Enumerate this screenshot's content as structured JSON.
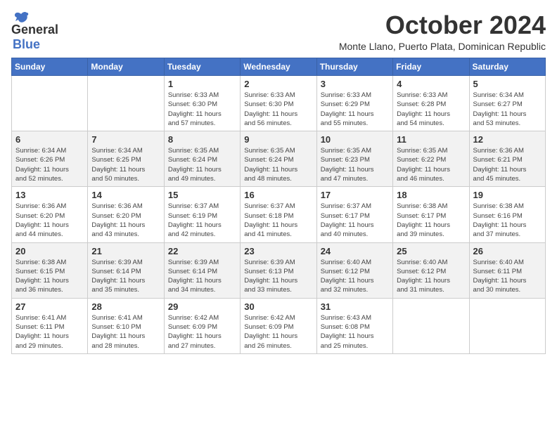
{
  "logo": {
    "text_general": "General",
    "text_blue": "Blue",
    "bird_unicode": "🐦"
  },
  "header": {
    "month": "October 2024",
    "location": "Monte Llano, Puerto Plata, Dominican Republic"
  },
  "days_of_week": [
    "Sunday",
    "Monday",
    "Tuesday",
    "Wednesday",
    "Thursday",
    "Friday",
    "Saturday"
  ],
  "weeks": [
    [
      {
        "day": "",
        "info": ""
      },
      {
        "day": "",
        "info": ""
      },
      {
        "day": "1",
        "info": "Sunrise: 6:33 AM\nSunset: 6:30 PM\nDaylight: 11 hours\nand 57 minutes."
      },
      {
        "day": "2",
        "info": "Sunrise: 6:33 AM\nSunset: 6:30 PM\nDaylight: 11 hours\nand 56 minutes."
      },
      {
        "day": "3",
        "info": "Sunrise: 6:33 AM\nSunset: 6:29 PM\nDaylight: 11 hours\nand 55 minutes."
      },
      {
        "day": "4",
        "info": "Sunrise: 6:33 AM\nSunset: 6:28 PM\nDaylight: 11 hours\nand 54 minutes."
      },
      {
        "day": "5",
        "info": "Sunrise: 6:34 AM\nSunset: 6:27 PM\nDaylight: 11 hours\nand 53 minutes."
      }
    ],
    [
      {
        "day": "6",
        "info": "Sunrise: 6:34 AM\nSunset: 6:26 PM\nDaylight: 11 hours\nand 52 minutes."
      },
      {
        "day": "7",
        "info": "Sunrise: 6:34 AM\nSunset: 6:25 PM\nDaylight: 11 hours\nand 50 minutes."
      },
      {
        "day": "8",
        "info": "Sunrise: 6:35 AM\nSunset: 6:24 PM\nDaylight: 11 hours\nand 49 minutes."
      },
      {
        "day": "9",
        "info": "Sunrise: 6:35 AM\nSunset: 6:24 PM\nDaylight: 11 hours\nand 48 minutes."
      },
      {
        "day": "10",
        "info": "Sunrise: 6:35 AM\nSunset: 6:23 PM\nDaylight: 11 hours\nand 47 minutes."
      },
      {
        "day": "11",
        "info": "Sunrise: 6:35 AM\nSunset: 6:22 PM\nDaylight: 11 hours\nand 46 minutes."
      },
      {
        "day": "12",
        "info": "Sunrise: 6:36 AM\nSunset: 6:21 PM\nDaylight: 11 hours\nand 45 minutes."
      }
    ],
    [
      {
        "day": "13",
        "info": "Sunrise: 6:36 AM\nSunset: 6:20 PM\nDaylight: 11 hours\nand 44 minutes."
      },
      {
        "day": "14",
        "info": "Sunrise: 6:36 AM\nSunset: 6:20 PM\nDaylight: 11 hours\nand 43 minutes."
      },
      {
        "day": "15",
        "info": "Sunrise: 6:37 AM\nSunset: 6:19 PM\nDaylight: 11 hours\nand 42 minutes."
      },
      {
        "day": "16",
        "info": "Sunrise: 6:37 AM\nSunset: 6:18 PM\nDaylight: 11 hours\nand 41 minutes."
      },
      {
        "day": "17",
        "info": "Sunrise: 6:37 AM\nSunset: 6:17 PM\nDaylight: 11 hours\nand 40 minutes."
      },
      {
        "day": "18",
        "info": "Sunrise: 6:38 AM\nSunset: 6:17 PM\nDaylight: 11 hours\nand 39 minutes."
      },
      {
        "day": "19",
        "info": "Sunrise: 6:38 AM\nSunset: 6:16 PM\nDaylight: 11 hours\nand 37 minutes."
      }
    ],
    [
      {
        "day": "20",
        "info": "Sunrise: 6:38 AM\nSunset: 6:15 PM\nDaylight: 11 hours\nand 36 minutes."
      },
      {
        "day": "21",
        "info": "Sunrise: 6:39 AM\nSunset: 6:14 PM\nDaylight: 11 hours\nand 35 minutes."
      },
      {
        "day": "22",
        "info": "Sunrise: 6:39 AM\nSunset: 6:14 PM\nDaylight: 11 hours\nand 34 minutes."
      },
      {
        "day": "23",
        "info": "Sunrise: 6:39 AM\nSunset: 6:13 PM\nDaylight: 11 hours\nand 33 minutes."
      },
      {
        "day": "24",
        "info": "Sunrise: 6:40 AM\nSunset: 6:12 PM\nDaylight: 11 hours\nand 32 minutes."
      },
      {
        "day": "25",
        "info": "Sunrise: 6:40 AM\nSunset: 6:12 PM\nDaylight: 11 hours\nand 31 minutes."
      },
      {
        "day": "26",
        "info": "Sunrise: 6:40 AM\nSunset: 6:11 PM\nDaylight: 11 hours\nand 30 minutes."
      }
    ],
    [
      {
        "day": "27",
        "info": "Sunrise: 6:41 AM\nSunset: 6:11 PM\nDaylight: 11 hours\nand 29 minutes."
      },
      {
        "day": "28",
        "info": "Sunrise: 6:41 AM\nSunset: 6:10 PM\nDaylight: 11 hours\nand 28 minutes."
      },
      {
        "day": "29",
        "info": "Sunrise: 6:42 AM\nSunset: 6:09 PM\nDaylight: 11 hours\nand 27 minutes."
      },
      {
        "day": "30",
        "info": "Sunrise: 6:42 AM\nSunset: 6:09 PM\nDaylight: 11 hours\nand 26 minutes."
      },
      {
        "day": "31",
        "info": "Sunrise: 6:43 AM\nSunset: 6:08 PM\nDaylight: 11 hours\nand 25 minutes."
      },
      {
        "day": "",
        "info": ""
      },
      {
        "day": "",
        "info": ""
      }
    ]
  ]
}
